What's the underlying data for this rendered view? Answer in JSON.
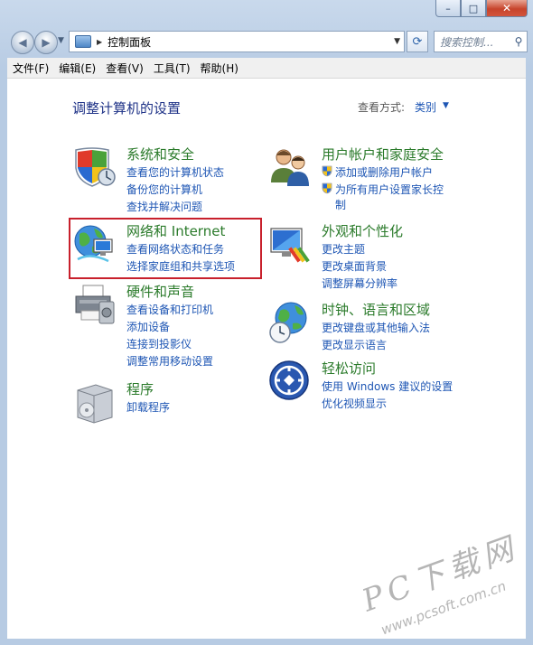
{
  "window": {
    "minimize_glyph": "–",
    "maximize_glyph": "□",
    "close_glyph": "✕"
  },
  "nav": {
    "back_glyph": "◀",
    "forward_glyph": "▶",
    "address_path": "控制面板",
    "search_placeholder": "搜索控制..."
  },
  "menu": {
    "items": [
      "文件(F)",
      "编辑(E)",
      "查看(V)",
      "工具(T)",
      "帮助(H)"
    ]
  },
  "header": {
    "title": "调整计算机的设置",
    "view_by_label": "查看方式:",
    "view_by_value": "类别"
  },
  "categories": {
    "system": {
      "title": "系统和安全",
      "links": [
        "查看您的计算机状态",
        "备份您的计算机",
        "查找并解决问题"
      ]
    },
    "network": {
      "title": "网络和 Internet",
      "links": [
        "查看网络状态和任务",
        "选择家庭组和共享选项"
      ]
    },
    "hardware": {
      "title": "硬件和声音",
      "links": [
        "查看设备和打印机",
        "添加设备",
        "连接到投影仪",
        "调整常用移动设置"
      ]
    },
    "programs": {
      "title": "程序",
      "links": [
        "卸载程序"
      ]
    },
    "users": {
      "title": "用户帐户和家庭安全",
      "links": [
        "添加或删除用户帐户",
        "为所有用户设置家长控",
        "制"
      ]
    },
    "appearance": {
      "title": "外观和个性化",
      "links": [
        "更改主题",
        "更改桌面背景",
        "调整屏幕分辨率"
      ]
    },
    "clock": {
      "title": "时钟、语言和区域",
      "links": [
        "更改键盘或其他输入法",
        "更改显示语言"
      ]
    },
    "ease": {
      "title": "轻松访问",
      "links": [
        "使用 Windows 建议的设置",
        "优化视频显示"
      ]
    }
  },
  "watermark": {
    "text": "PC下载网",
    "url": "www.pcsoft.com.cn"
  },
  "colors": {
    "category_title": "#2a7a2a",
    "link": "#1e56b4",
    "highlight": "#c8202c",
    "page_title": "#1e3287"
  }
}
